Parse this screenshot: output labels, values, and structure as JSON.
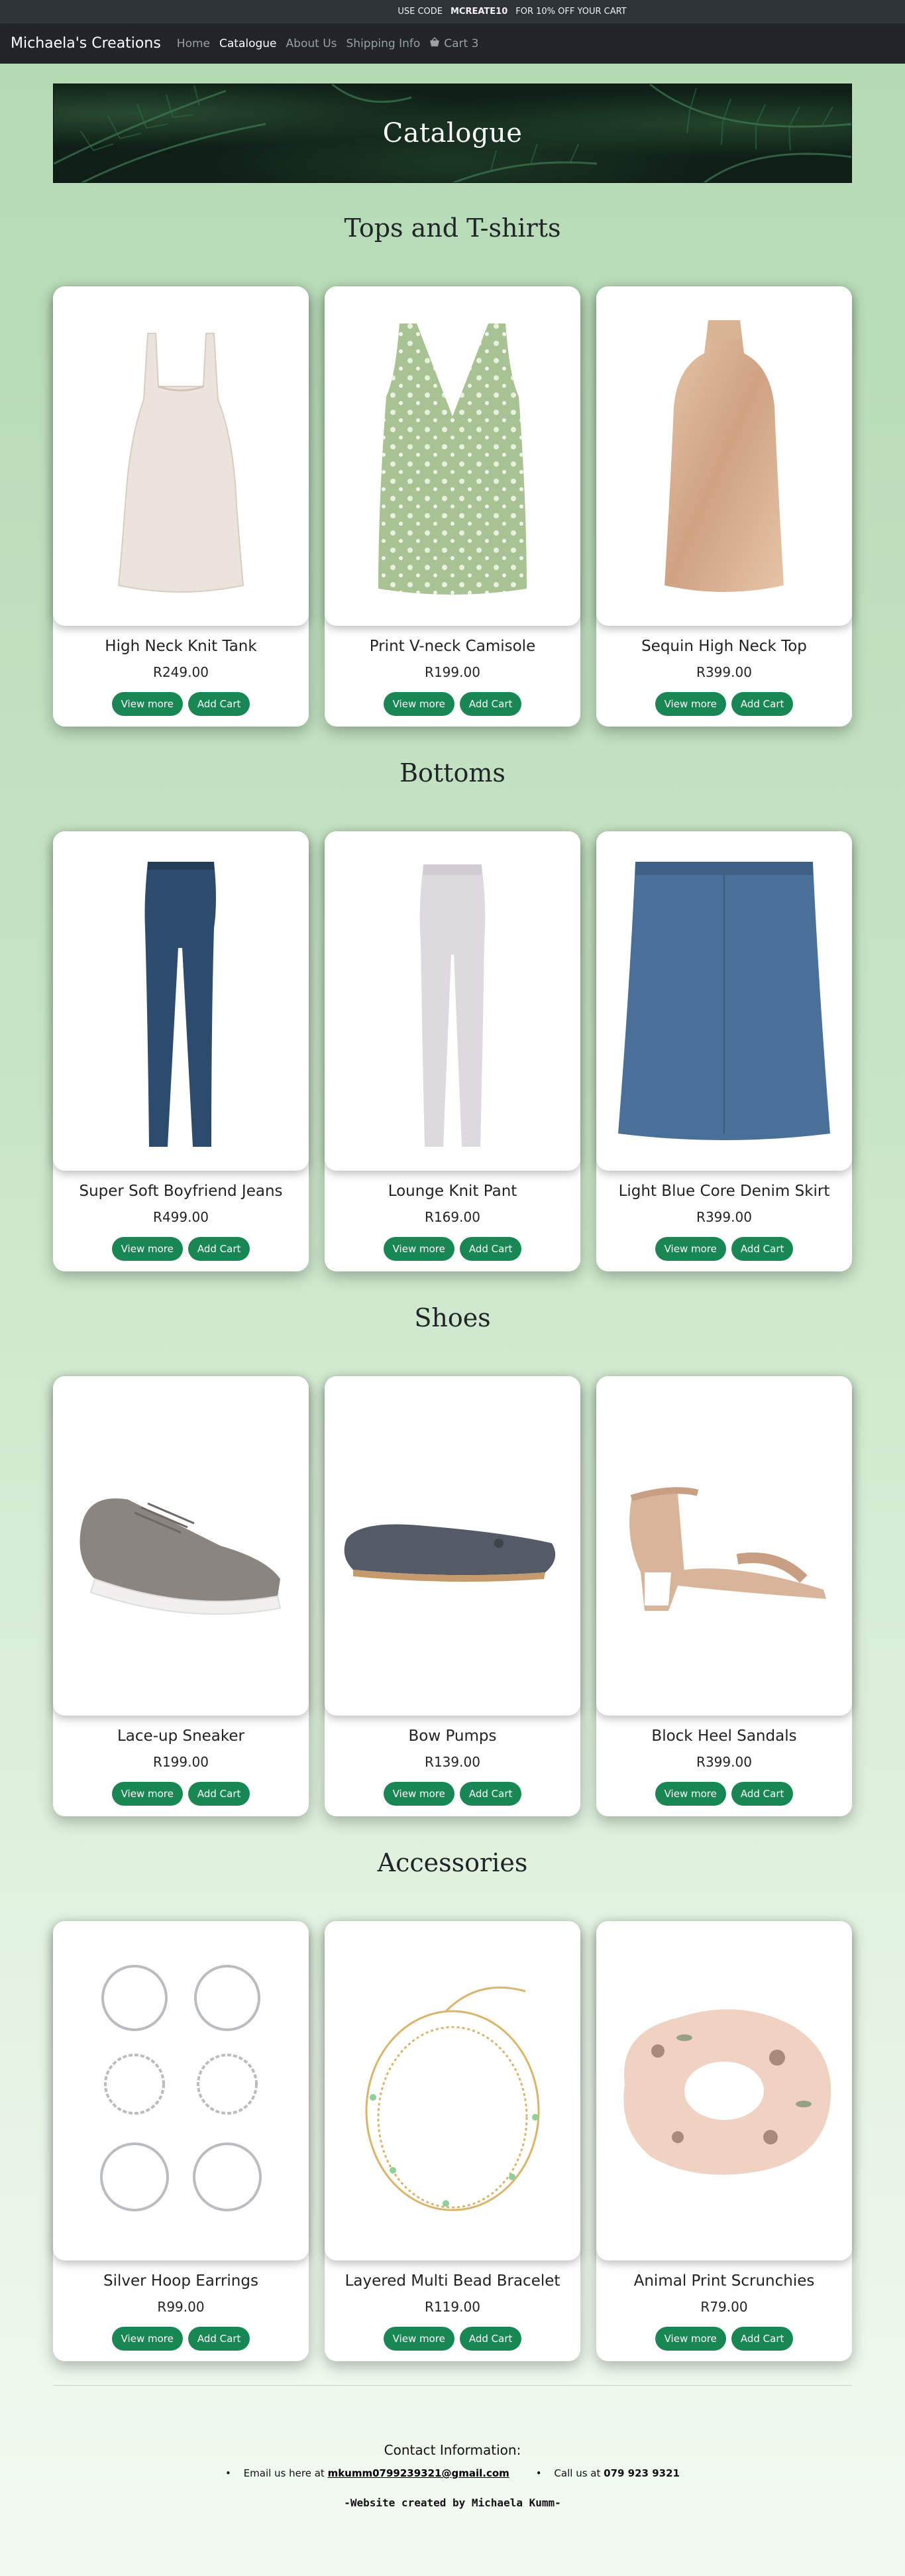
{
  "promo": {
    "prefix": "USE CODE",
    "code": "MCREATE10",
    "suffix": "FOR 10% OFF YOUR CART"
  },
  "nav": {
    "brand": "Michaela's Creations",
    "links": [
      "Home",
      "Catalogue",
      "About Us",
      "Shipping Info"
    ],
    "active": "Catalogue",
    "cart_label": "Cart 3",
    "cart_icon": "shopping-basket-icon"
  },
  "banner": {
    "title": "Catalogue"
  },
  "buttons": {
    "view_more": "View more",
    "add_cart": "Add Cart"
  },
  "sections": [
    {
      "title": "Tops and T-shirts",
      "products": [
        {
          "name": "High Neck Knit Tank",
          "price": "R249.00",
          "image": "knit-tank-image"
        },
        {
          "name": "Print V-neck Camisole",
          "price": "R199.00",
          "image": "camisole-image"
        },
        {
          "name": "Sequin High Neck Top",
          "price": "R399.00",
          "image": "sequin-top-image"
        }
      ]
    },
    {
      "title": "Bottoms",
      "products": [
        {
          "name": "Super Soft Boyfriend Jeans",
          "price": "R499.00",
          "image": "jeans-image"
        },
        {
          "name": "Lounge Knit Pant",
          "price": "R169.00",
          "image": "lounge-pant-image"
        },
        {
          "name": "Light Blue Core Denim Skirt",
          "price": "R399.00",
          "image": "denim-skirt-image"
        }
      ]
    },
    {
      "title": "Shoes",
      "products": [
        {
          "name": "Lace-up Sneaker",
          "price": "R199.00",
          "image": "sneaker-image"
        },
        {
          "name": "Bow Pumps",
          "price": "R139.00",
          "image": "bow-pumps-image"
        },
        {
          "name": "Block Heel Sandals",
          "price": "R399.00",
          "image": "sandals-image"
        }
      ]
    },
    {
      "title": "Accessories",
      "products": [
        {
          "name": "Silver Hoop Earrings",
          "price": "R99.00",
          "image": "hoop-earrings-image"
        },
        {
          "name": "Layered Multi Bead Bracelet",
          "price": "R119.00",
          "image": "bracelet-image"
        },
        {
          "name": "Animal Print Scrunchies",
          "price": "R79.00",
          "image": "scrunchies-image"
        }
      ]
    }
  ],
  "footer": {
    "contact_title": "Contact Information:",
    "email_prefix": "Email us here at",
    "email": "mkumm0799239321@gmail.com",
    "phone_prefix": "Call us at",
    "phone": "079 923 9321",
    "credit": "-Website created by Michaela Kumm-"
  },
  "colors": {
    "accent": "#198754",
    "navbar": "#212529",
    "promo": "#2e3338"
  }
}
